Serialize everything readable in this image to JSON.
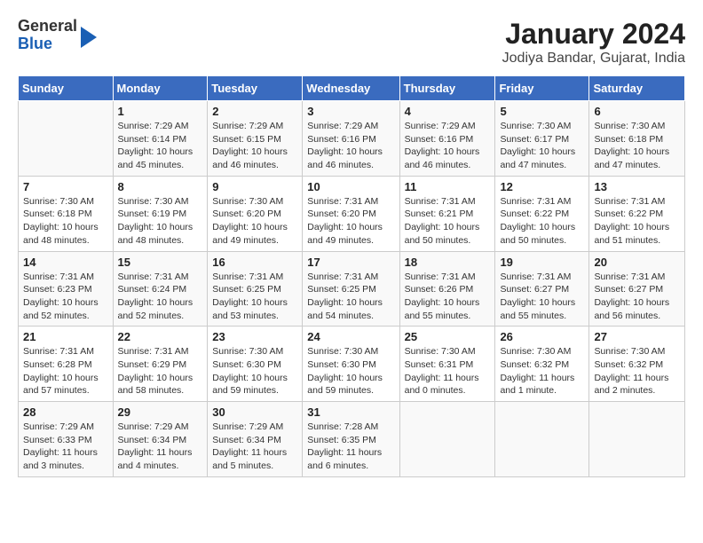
{
  "logo": {
    "line1": "General",
    "line2": "Blue"
  },
  "title": "January 2024",
  "subtitle": "Jodiya Bandar, Gujarat, India",
  "days_of_week": [
    "Sunday",
    "Monday",
    "Tuesday",
    "Wednesday",
    "Thursday",
    "Friday",
    "Saturday"
  ],
  "weeks": [
    [
      {
        "num": "",
        "info": ""
      },
      {
        "num": "1",
        "info": "Sunrise: 7:29 AM\nSunset: 6:14 PM\nDaylight: 10 hours\nand 45 minutes."
      },
      {
        "num": "2",
        "info": "Sunrise: 7:29 AM\nSunset: 6:15 PM\nDaylight: 10 hours\nand 46 minutes."
      },
      {
        "num": "3",
        "info": "Sunrise: 7:29 AM\nSunset: 6:16 PM\nDaylight: 10 hours\nand 46 minutes."
      },
      {
        "num": "4",
        "info": "Sunrise: 7:29 AM\nSunset: 6:16 PM\nDaylight: 10 hours\nand 46 minutes."
      },
      {
        "num": "5",
        "info": "Sunrise: 7:30 AM\nSunset: 6:17 PM\nDaylight: 10 hours\nand 47 minutes."
      },
      {
        "num": "6",
        "info": "Sunrise: 7:30 AM\nSunset: 6:18 PM\nDaylight: 10 hours\nand 47 minutes."
      }
    ],
    [
      {
        "num": "7",
        "info": "Sunrise: 7:30 AM\nSunset: 6:18 PM\nDaylight: 10 hours\nand 48 minutes."
      },
      {
        "num": "8",
        "info": "Sunrise: 7:30 AM\nSunset: 6:19 PM\nDaylight: 10 hours\nand 48 minutes."
      },
      {
        "num": "9",
        "info": "Sunrise: 7:30 AM\nSunset: 6:20 PM\nDaylight: 10 hours\nand 49 minutes."
      },
      {
        "num": "10",
        "info": "Sunrise: 7:31 AM\nSunset: 6:20 PM\nDaylight: 10 hours\nand 49 minutes."
      },
      {
        "num": "11",
        "info": "Sunrise: 7:31 AM\nSunset: 6:21 PM\nDaylight: 10 hours\nand 50 minutes."
      },
      {
        "num": "12",
        "info": "Sunrise: 7:31 AM\nSunset: 6:22 PM\nDaylight: 10 hours\nand 50 minutes."
      },
      {
        "num": "13",
        "info": "Sunrise: 7:31 AM\nSunset: 6:22 PM\nDaylight: 10 hours\nand 51 minutes."
      }
    ],
    [
      {
        "num": "14",
        "info": "Sunrise: 7:31 AM\nSunset: 6:23 PM\nDaylight: 10 hours\nand 52 minutes."
      },
      {
        "num": "15",
        "info": "Sunrise: 7:31 AM\nSunset: 6:24 PM\nDaylight: 10 hours\nand 52 minutes."
      },
      {
        "num": "16",
        "info": "Sunrise: 7:31 AM\nSunset: 6:25 PM\nDaylight: 10 hours\nand 53 minutes."
      },
      {
        "num": "17",
        "info": "Sunrise: 7:31 AM\nSunset: 6:25 PM\nDaylight: 10 hours\nand 54 minutes."
      },
      {
        "num": "18",
        "info": "Sunrise: 7:31 AM\nSunset: 6:26 PM\nDaylight: 10 hours\nand 55 minutes."
      },
      {
        "num": "19",
        "info": "Sunrise: 7:31 AM\nSunset: 6:27 PM\nDaylight: 10 hours\nand 55 minutes."
      },
      {
        "num": "20",
        "info": "Sunrise: 7:31 AM\nSunset: 6:27 PM\nDaylight: 10 hours\nand 56 minutes."
      }
    ],
    [
      {
        "num": "21",
        "info": "Sunrise: 7:31 AM\nSunset: 6:28 PM\nDaylight: 10 hours\nand 57 minutes."
      },
      {
        "num": "22",
        "info": "Sunrise: 7:31 AM\nSunset: 6:29 PM\nDaylight: 10 hours\nand 58 minutes."
      },
      {
        "num": "23",
        "info": "Sunrise: 7:30 AM\nSunset: 6:30 PM\nDaylight: 10 hours\nand 59 minutes."
      },
      {
        "num": "24",
        "info": "Sunrise: 7:30 AM\nSunset: 6:30 PM\nDaylight: 10 hours\nand 59 minutes."
      },
      {
        "num": "25",
        "info": "Sunrise: 7:30 AM\nSunset: 6:31 PM\nDaylight: 11 hours\nand 0 minutes."
      },
      {
        "num": "26",
        "info": "Sunrise: 7:30 AM\nSunset: 6:32 PM\nDaylight: 11 hours\nand 1 minute."
      },
      {
        "num": "27",
        "info": "Sunrise: 7:30 AM\nSunset: 6:32 PM\nDaylight: 11 hours\nand 2 minutes."
      }
    ],
    [
      {
        "num": "28",
        "info": "Sunrise: 7:29 AM\nSunset: 6:33 PM\nDaylight: 11 hours\nand 3 minutes."
      },
      {
        "num": "29",
        "info": "Sunrise: 7:29 AM\nSunset: 6:34 PM\nDaylight: 11 hours\nand 4 minutes."
      },
      {
        "num": "30",
        "info": "Sunrise: 7:29 AM\nSunset: 6:34 PM\nDaylight: 11 hours\nand 5 minutes."
      },
      {
        "num": "31",
        "info": "Sunrise: 7:28 AM\nSunset: 6:35 PM\nDaylight: 11 hours\nand 6 minutes."
      },
      {
        "num": "",
        "info": ""
      },
      {
        "num": "",
        "info": ""
      },
      {
        "num": "",
        "info": ""
      }
    ]
  ]
}
